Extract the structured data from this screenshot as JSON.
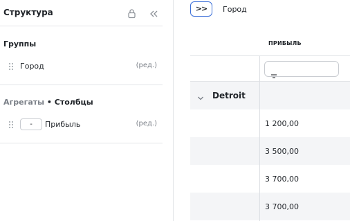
{
  "panel": {
    "title": "Структура",
    "icons": {
      "lock": "lock-icon",
      "collapse": "double-chevron-left-icon"
    }
  },
  "groups": {
    "title": "Группы",
    "items": [
      {
        "label": "Город",
        "edit": "(ред.)"
      }
    ]
  },
  "aggregates": {
    "title_muted": "Агрегаты",
    "title_separator": " • ",
    "title_main": "Столбцы",
    "items": [
      {
        "agg": "-",
        "label": "Прибыль",
        "edit": "(ред.)"
      }
    ]
  },
  "toolbar": {
    "expand_label": ">>",
    "group_chip": "Город",
    "chip_dots": "··"
  },
  "table": {
    "column_header": "ПРИБЫЛЬ",
    "filter_icon": "filter-icon",
    "group_row": {
      "label": "Detroit",
      "icon": "chevron-down-icon"
    },
    "rows": [
      {
        "value": "1 200,00"
      },
      {
        "value": "3 500,00"
      },
      {
        "value": "3 700,00"
      },
      {
        "value": "3 700,00"
      }
    ]
  },
  "colors": {
    "accent": "#3b6fd8",
    "border": "#e3e5e8",
    "shaded_row": "#f4f5f7",
    "muted_text": "#7a7f87"
  }
}
